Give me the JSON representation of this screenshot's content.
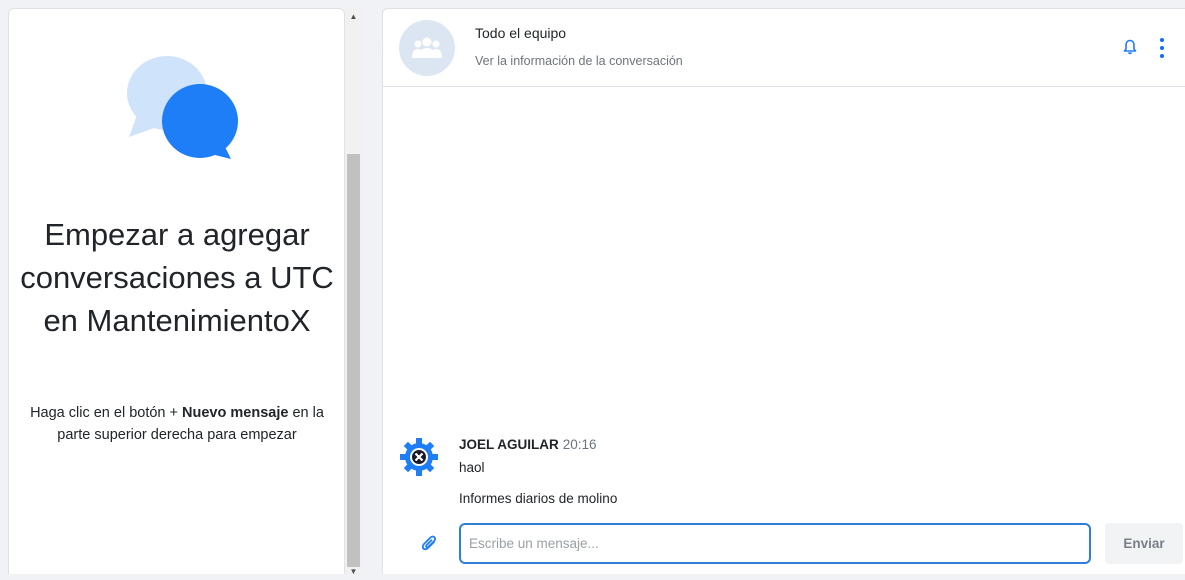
{
  "empty_state": {
    "title": "Empezar a agregar conversaciones a UTC en MantenimientoX",
    "desc_prefix": "Haga clic en el botón + ",
    "desc_bold": "Nuevo mensaje",
    "desc_suffix": " en la parte superior derecha para empezar"
  },
  "conversation": {
    "title": "Todo el equipo",
    "info_link": "Ver la información de la conversación"
  },
  "message": {
    "author": "JOEL AGUILAR",
    "time": "20:16",
    "lines": [
      "haol",
      "Informes diarios de molino"
    ]
  },
  "composer": {
    "placeholder": "Escribe un mensaje...",
    "send_label": "Enviar"
  },
  "colors": {
    "accent": "#1e7ef7",
    "avatar_bg": "#dce6f3"
  },
  "icons": [
    "chat-bubbles-icon",
    "group-icon",
    "bell-icon",
    "more-vertical-icon",
    "paperclip-icon",
    "user-avatar-icon"
  ]
}
